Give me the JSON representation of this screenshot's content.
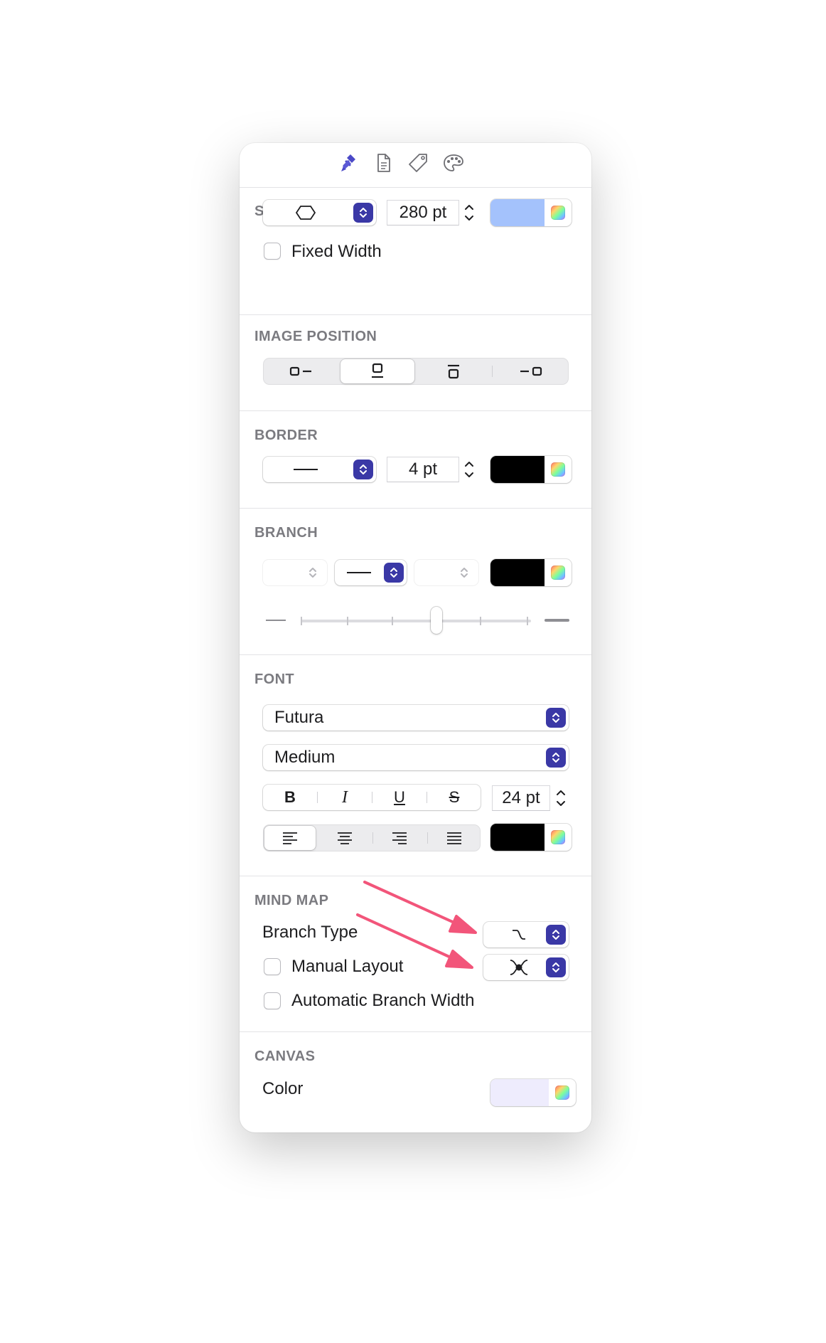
{
  "toolbar": {
    "icons": [
      "style-brush-icon",
      "document-icon",
      "tag-icon",
      "palette-icon"
    ],
    "active_color": "#4b49c7"
  },
  "shape": {
    "title": "SHAPE",
    "shape_value": "hexagon",
    "width_value": "280 pt",
    "fill_color": "#a4c2fc",
    "fixed_width_label": "Fixed Width",
    "fixed_width_checked": false
  },
  "image_position": {
    "title": "IMAGE POSITION",
    "options": [
      "left",
      "bottom",
      "top",
      "right"
    ],
    "selected": "bottom"
  },
  "border": {
    "title": "BORDER",
    "style": "solid-line",
    "width_value": "4 pt",
    "color": "#000000"
  },
  "branch": {
    "title": "BRANCH",
    "line_style": "solid-line",
    "color": "#000000",
    "thickness_fraction": 0.6
  },
  "font": {
    "title": "FONT",
    "family": "Futura",
    "weight": "Medium",
    "bold_label": "B",
    "italic_label": "I",
    "underline_label": "U",
    "strike_label": "S",
    "size_value": "24 pt",
    "alignment": "left",
    "color": "#000000"
  },
  "mind_map": {
    "title": "MIND MAP",
    "branch_type_label": "Branch Type",
    "manual_layout_label": "Manual Layout",
    "manual_layout_checked": false,
    "auto_branch_width_label": "Automatic Branch Width",
    "auto_branch_width_checked": false,
    "annotation_color": "#f2557a"
  },
  "canvas": {
    "title": "CANVAS",
    "color_label": "Color",
    "color": "#eeecfd"
  },
  "colors": {
    "accent": "#3a38a6",
    "section_title": "#7b7b80"
  }
}
